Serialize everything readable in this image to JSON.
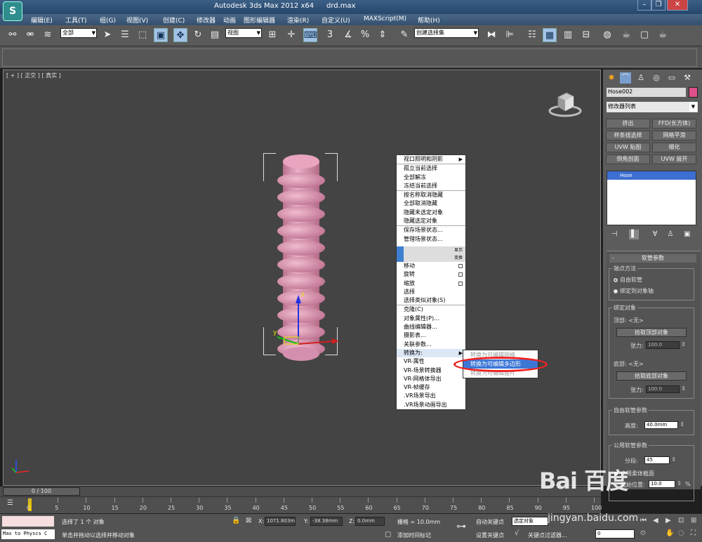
{
  "window": {
    "title": "Autodesk 3ds Max  2012 x64",
    "file": "drd.max",
    "logo": "S"
  },
  "menu": [
    "编辑(E)",
    "工具(T)",
    "组(G)",
    "视图(V)",
    "创建(C)",
    "修改器",
    "动画",
    "图形编辑器",
    "渲染(R)",
    "自定义(U)",
    "MAXScript(M)",
    "帮助(H)"
  ],
  "toolbar": {
    "filter": "全部",
    "coord": "视图",
    "selection_set": "创建选择集",
    "snap_3": "3",
    "snap_pct": "%"
  },
  "viewport": {
    "label": "[ + ] [ 正交 ] [ 真实 ]",
    "gizmo_y": "y",
    "gizmo_z": "z"
  },
  "context_menu": {
    "items_a": [
      "视口照明和阴影"
    ],
    "items_b": [
      "孤立当前选择",
      "全部解冻",
      "冻结当前选择"
    ],
    "items_c": [
      "按名称取消隐藏",
      "全部取消隐藏",
      "隐藏未选定对象",
      "隐藏选定对象"
    ],
    "items_d": [
      "保存场景状态...",
      "管理场景状态..."
    ],
    "bar1": "显示",
    "bar2": "变换",
    "items_e": [
      "移动",
      "旋转",
      "缩放",
      "选择",
      "选择类似对象(S)"
    ],
    "items_f": [
      "克隆(C)",
      "对象属性(P)...",
      "曲线编辑器...",
      "摄影表...",
      "关联参数..."
    ],
    "convert": "转换为:",
    "items_g": [
      "VR-属性",
      "VR-场景转换器",
      "VR-网格体导出",
      "VR-帧缓存",
      ".VR场景导出",
      ".VR场景动画导出"
    ]
  },
  "submenu": {
    "items": [
      "转换为可编辑网格",
      "转换为可编辑多边形",
      "转换为可编辑面片"
    ]
  },
  "panel": {
    "object_name": "Hose002",
    "modifier_list": "修改器列表",
    "buttons": [
      "挤出",
      "FFD(长方体)",
      "样条线选择",
      "网格平滑",
      "UVW 贴图",
      "细化",
      "倒角剖面",
      "UVW 展开"
    ],
    "stack_item": "Hose",
    "rollout": "软管参数",
    "endpoint_group": "端点方法",
    "free_hose": "自由软管",
    "bound_hose": "绑定到对象轴",
    "binding_group": "绑定对象",
    "top_label": "顶部: <无>",
    "pick_top": "拾取顶部对象",
    "tension_label": "张力:",
    "tension_top": "100.0",
    "bottom_label": "底部: <无>",
    "pick_bottom": "拾取底部对象",
    "tension_bottom": "100.0",
    "free_params": "自由软管参数",
    "height_label": "高度:",
    "height_value": "40.0mm",
    "common_params": "公用软管参数",
    "segments_label": "分段:",
    "segments_value": "45",
    "flex_label": "启用柔体截面",
    "start_label": "起始位置:",
    "start_value": "10.0",
    "pct": "%"
  },
  "timeline": {
    "frame": "0 / 100",
    "ticks": [
      "0",
      "5",
      "10",
      "15",
      "20",
      "25",
      "30",
      "35",
      "40",
      "45",
      "50",
      "55",
      "60",
      "65",
      "70",
      "75",
      "80",
      "85",
      "90",
      "95",
      "100"
    ]
  },
  "status": {
    "maxscript": "Max to Physcs C",
    "selected": "选择了 1 个 对象",
    "hint": "单击并拖动以选择并移动对象",
    "x_label": "X:",
    "x_value": "1071.803m",
    "y_label": "Y:",
    "y_value": "-38.38mm",
    "z_label": "Z:",
    "z_value": "0.0mm",
    "grid": "栅格 = 10.0mm",
    "add_time_tag": "添加时间标记",
    "auto_key": "自动关键点",
    "set_key": "设置关键点",
    "selected_obj": "选定对象",
    "key_filter": "关键点过滤器...",
    "frame_field": "0"
  },
  "watermark": {
    "brand": "Bai 百度",
    "site": "jingyan.baidu.com"
  }
}
